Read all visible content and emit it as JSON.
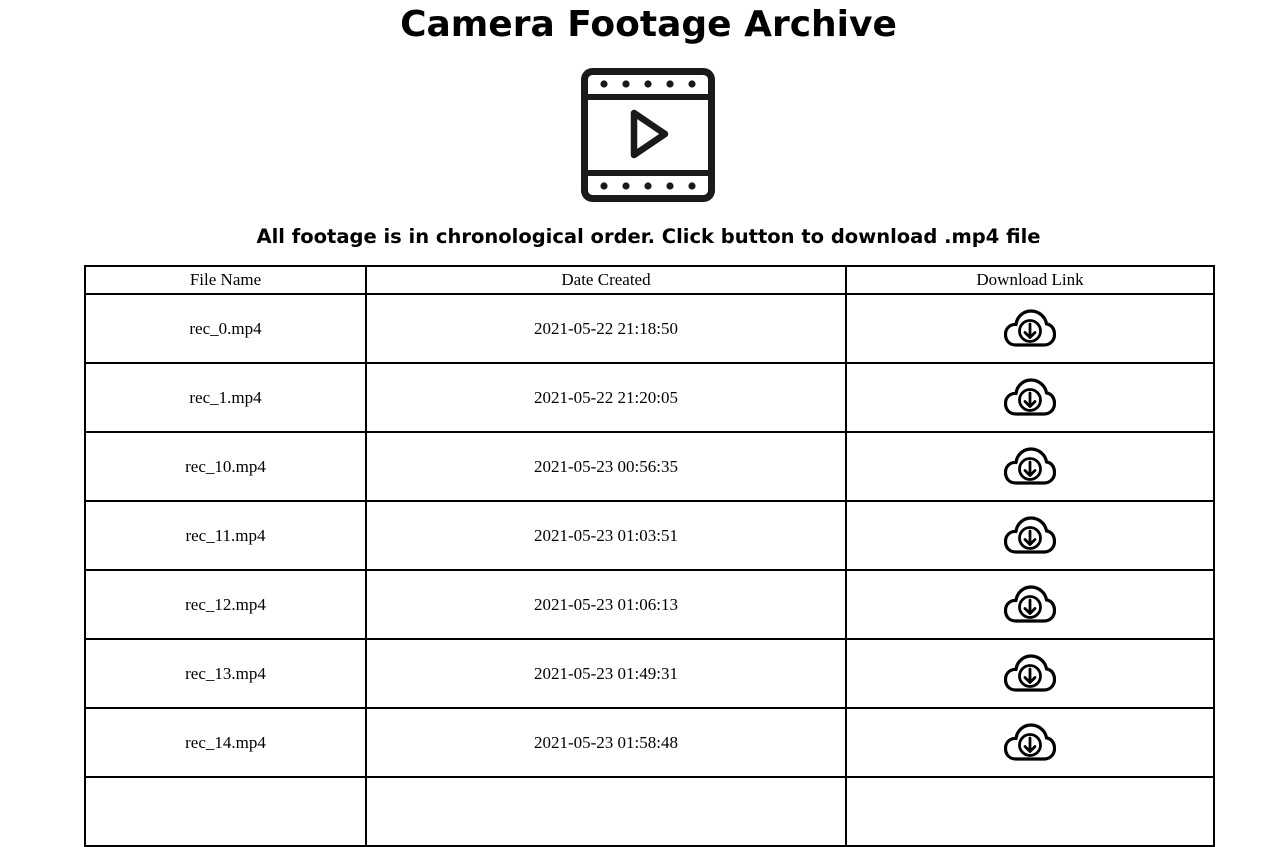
{
  "page": {
    "title": "Camera Footage Archive",
    "subtitle": "All footage is in chronological order. Click button to download .mp4 file",
    "header_icon": "video-film-icon"
  },
  "table": {
    "headers": [
      "File Name",
      "Date Created",
      "Download Link"
    ],
    "download_icon": "cloud-download-icon",
    "rows": [
      {
        "file": "rec_0.mp4",
        "date": "2021-05-22 21:18:50"
      },
      {
        "file": "rec_1.mp4",
        "date": "2021-05-22 21:20:05"
      },
      {
        "file": "rec_10.mp4",
        "date": "2021-05-23 00:56:35"
      },
      {
        "file": "rec_11.mp4",
        "date": "2021-05-23 01:03:51"
      },
      {
        "file": "rec_12.mp4",
        "date": "2021-05-23 01:06:13"
      },
      {
        "file": "rec_13.mp4",
        "date": "2021-05-23 01:49:31"
      },
      {
        "file": "rec_14.mp4",
        "date": "2021-05-23 01:58:48"
      },
      {
        "file": "",
        "date": ""
      }
    ]
  }
}
